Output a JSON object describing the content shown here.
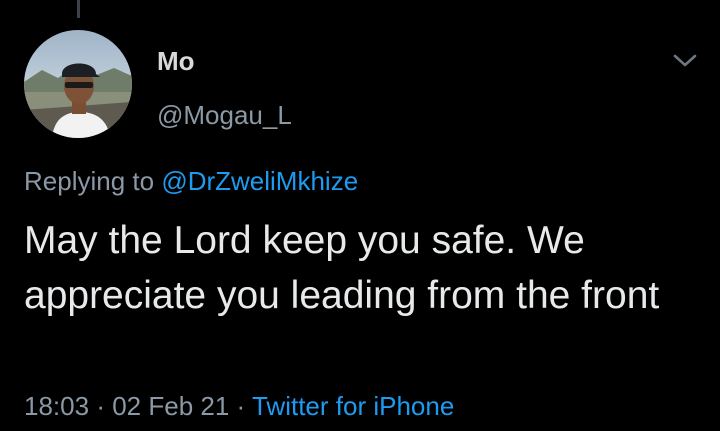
{
  "tweet": {
    "display_name": "Mo",
    "handle": "@Mogau_L",
    "replying_prefix": "Replying to",
    "replying_to": "@DrZweliMkhize",
    "text": "May the Lord keep you safe. We appreciate you leading from the front",
    "time": "18:03",
    "separator": "·",
    "date": "02 Feb 21",
    "source": "Twitter for iPhone"
  },
  "icons": {
    "more": "chevron-down-icon"
  },
  "colors": {
    "background": "#000000",
    "name": "#d9d9d9",
    "secondary": "#8b98a5",
    "link": "#1d9bf0",
    "body_text": "#e7e9ea"
  }
}
